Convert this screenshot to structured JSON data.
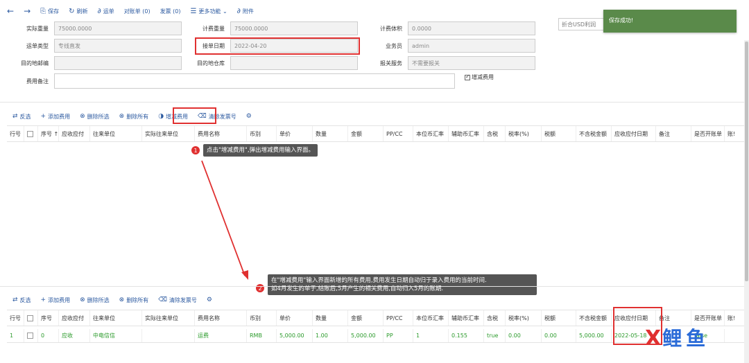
{
  "toolbar": {
    "back": "←",
    "forward": "→",
    "items": [
      {
        "icon": "save-icon",
        "glyph": "⎘",
        "label": "保存"
      },
      {
        "icon": "refresh-icon",
        "glyph": "↻",
        "label": "刷新"
      },
      {
        "icon": "link-icon",
        "glyph": "∂",
        "label": "运单"
      },
      {
        "icon": "",
        "glyph": "",
        "label": "对账单 (0)"
      },
      {
        "icon": "",
        "glyph": "",
        "label": "发票 (0)"
      },
      {
        "icon": "menu-icon",
        "glyph": "☰",
        "label": "更多功能 ⌄"
      },
      {
        "icon": "attachment-icon",
        "glyph": "∂",
        "label": "附件"
      }
    ]
  },
  "form": {
    "actual_weight_label": "实际重量",
    "actual_weight_value": "75000.0000",
    "charge_weight_label": "计费重量",
    "charge_weight_value": "75000.0000",
    "charge_volume_label": "计费体积",
    "charge_volume_value": "0.0000",
    "waybill_type_label": "运单类型",
    "waybill_type_value": "专线直发",
    "order_date_label": "接单日期",
    "order_date_value": "2022-04-20",
    "salesman_label": "业务员",
    "salesman_value": "admin",
    "dest_zip_label": "目的地邮编",
    "dest_zip_value": "",
    "dest_warehouse_label": "目的地仓库",
    "dest_warehouse_value": "",
    "customs_label": "报关服务",
    "customs_value": "不需要报关",
    "fee_remark_label": "费用备注",
    "fee_remark_value": "",
    "add_fee_check_label": "增减费用"
  },
  "toast": {
    "message": "保存成功!",
    "underlying_field": "折合USD利润"
  },
  "grid1": {
    "toolbar": [
      {
        "icon": "swap-icon",
        "glyph": "⇄",
        "label": "反选"
      },
      {
        "icon": "add-icon",
        "glyph": "+",
        "label": "添加费用"
      },
      {
        "icon": "delete-icon",
        "glyph": "⊗",
        "label": "删除所选"
      },
      {
        "icon": "delete-all-icon",
        "glyph": "⊗",
        "label": "删除所有"
      },
      {
        "icon": "adjust-icon",
        "glyph": "◑",
        "label": "增减费用"
      },
      {
        "icon": "clear-icon",
        "glyph": "⌫",
        "label": "清除发票号"
      },
      {
        "icon": "gear-icon",
        "glyph": "⚙",
        "label": ""
      }
    ],
    "columns": [
      "行号",
      "",
      "序号 ↑",
      "应收应付",
      "往来单位",
      "实际往来单位",
      "费用名称",
      "币别",
      "单价",
      "数量",
      "金额",
      "PP/CC",
      "本位币汇率",
      "辅助币汇率",
      "含税",
      "税率(%)",
      "税额",
      "不含税金额",
      "应收应付日期",
      "备注",
      "是否开账单",
      "账!"
    ]
  },
  "grid2": {
    "toolbar": [
      {
        "icon": "swap-icon",
        "glyph": "⇄",
        "label": "反选"
      },
      {
        "icon": "add-icon",
        "glyph": "+",
        "label": "添加费用"
      },
      {
        "icon": "delete-icon",
        "glyph": "⊗",
        "label": "删除所选"
      },
      {
        "icon": "delete-all-icon",
        "glyph": "⊗",
        "label": "删除所有"
      },
      {
        "icon": "clear-icon",
        "glyph": "⌫",
        "label": "清除发票号"
      },
      {
        "icon": "gear-icon",
        "glyph": "⚙",
        "label": ""
      }
    ],
    "columns": [
      "行号",
      "",
      "序号",
      "应收应付",
      "往来单位",
      "实际往来单位",
      "费用名称",
      "币别",
      "单价",
      "数量",
      "金额",
      "PP/CC",
      "本位币汇率",
      "辅助币汇率",
      "含税",
      "税率(%)",
      "税额",
      "不含税金额",
      "应收应付日期",
      "备注",
      "是否开账单",
      "账!"
    ],
    "rows": [
      [
        "1",
        "",
        "0",
        "应收",
        "中电信信",
        "",
        "运费",
        "RMB",
        "5,000.00",
        "1.00",
        "5,000.00",
        "PP",
        "1",
        "0.155",
        "true",
        "0.00",
        "0.00",
        "5,000.00",
        "2022-05-18",
        "",
        "false",
        ""
      ]
    ]
  },
  "annotations": {
    "tip1_num": "1",
    "tip1_text": "点击\"增减费用\",弹出增减费用输入界面。",
    "tip2_num": "2",
    "tip2_line1": "在\"增减费用\"输入界面新增的所有费用,费用发生日期自动归于录入费用的当前时间.",
    "tip2_line2": "如4月发生的单子,结账后,5月产生的相关费用,自动归入5月的账期."
  },
  "watermark": {
    "mark": "X",
    "text": "鲤鱼"
  }
}
